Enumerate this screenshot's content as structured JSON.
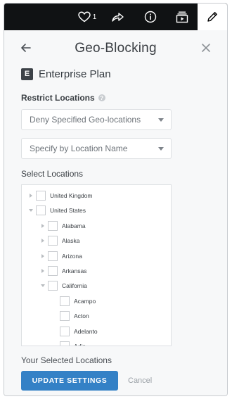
{
  "topbar": {
    "like_count": "1",
    "icons": [
      "heart-icon",
      "share-icon",
      "info-icon",
      "collection-icon",
      "pencil-icon"
    ]
  },
  "panel": {
    "title": "Geo-Blocking",
    "plan_badge": "E",
    "plan_name": "Enterprise Plan"
  },
  "restrict": {
    "label": "Restrict Locations",
    "help": "?",
    "mode_value": "Deny Specified Geo-locations",
    "method_value": "Specify by Location Name"
  },
  "select_locations": {
    "label": "Select Locations",
    "nodes": [
      {
        "label": "United Kingdom",
        "level": 0,
        "toggle": "right"
      },
      {
        "label": "United States",
        "level": 0,
        "toggle": "down"
      },
      {
        "label": "Alabama",
        "level": 1,
        "toggle": "right"
      },
      {
        "label": "Alaska",
        "level": 1,
        "toggle": "right"
      },
      {
        "label": "Arizona",
        "level": 1,
        "toggle": "right"
      },
      {
        "label": "Arkansas",
        "level": 1,
        "toggle": "right"
      },
      {
        "label": "California",
        "level": 1,
        "toggle": "down"
      },
      {
        "label": "Acampo",
        "level": 2,
        "toggle": "none"
      },
      {
        "label": "Acton",
        "level": 2,
        "toggle": "none"
      },
      {
        "label": "Adelanto",
        "level": 2,
        "toggle": "none"
      },
      {
        "label": "Adin",
        "level": 2,
        "toggle": "none"
      }
    ]
  },
  "selected": {
    "label": "Your Selected Locations"
  },
  "footer": {
    "update_label": "UPDATE SETTINGS",
    "cancel_label": "Cancel"
  },
  "colors": {
    "primary": "#3481c6",
    "topbar": "#101214"
  }
}
